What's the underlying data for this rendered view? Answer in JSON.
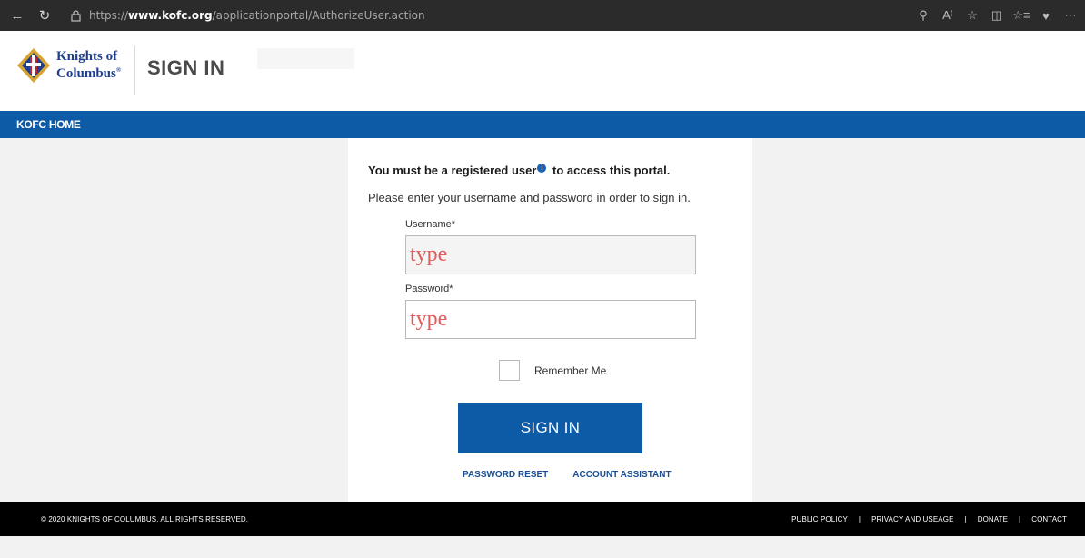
{
  "browser": {
    "url_prefix": "https://",
    "url_domain": "www.kofc.org",
    "url_path": "/applicationportal/AuthorizeUser.action",
    "icons": [
      "back-arrow-icon",
      "refresh-icon",
      "lock-icon",
      "read-aloud-icon",
      "reader-view-icon",
      "favorite-star-icon",
      "split-screen-icon",
      "favorites-list-icon",
      "extensions-icon",
      "more-icon"
    ]
  },
  "header": {
    "logo_line1": "Knights of",
    "logo_line2": "Columbus",
    "logo_mark": "®",
    "title": "SIGN IN"
  },
  "nav": {
    "home_label": "KOFC HOME"
  },
  "signin": {
    "lead_before": "You must be a registered user",
    "lead_after": " to access this portal.",
    "info_icon": "i",
    "instructions": "Please enter your username and password in order to sign in.",
    "username_label": "Username*",
    "username_placeholder": "type",
    "password_label": "Password*",
    "password_placeholder": "type",
    "remember_label": "Remember Me",
    "submit_label": "SIGN IN",
    "password_reset_label": "PASSWORD RESET",
    "account_assistant_label": "ACCOUNT ASSISTANT"
  },
  "footer": {
    "copyright": "© 2020 KNIGHTS OF COLUMBUS. ALL RIGHTS RESERVED.",
    "links": [
      "PUBLIC POLICY",
      "PRIVACY AND USEAGE",
      "DONATE",
      "CONTACT"
    ],
    "separator": "|"
  },
  "colors": {
    "brand_blue": "#0d5aa7",
    "typed_text": "#e15d5d",
    "footer_bg": "#000000"
  }
}
